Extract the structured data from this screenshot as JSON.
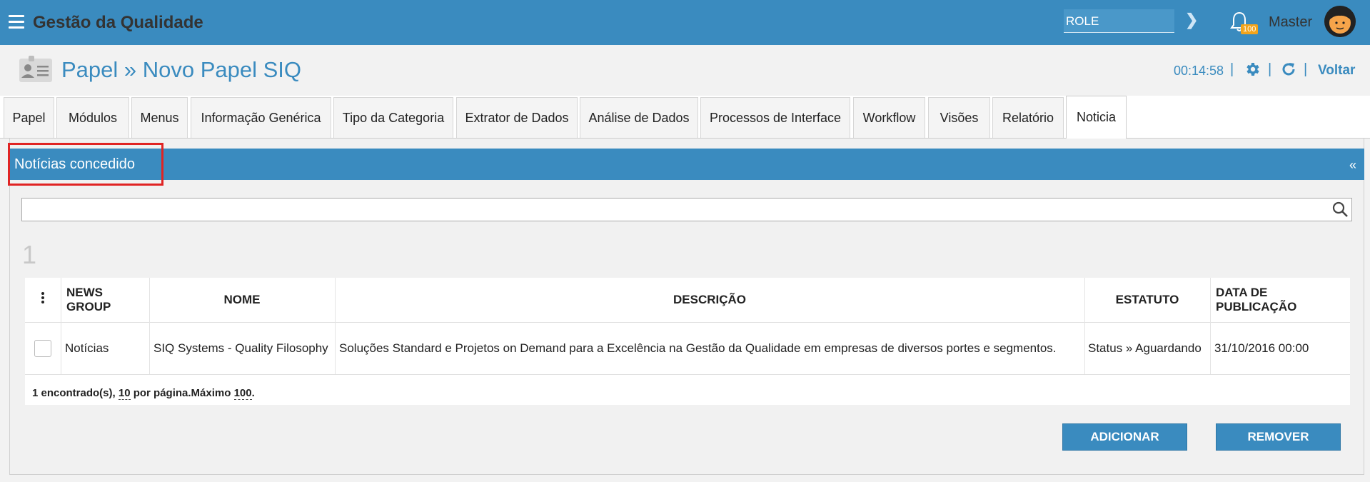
{
  "app": {
    "title": "Gestão da Qualidade"
  },
  "topbar": {
    "role_value": "ROLE",
    "notification_count": "100",
    "user_name": "Master"
  },
  "page": {
    "title": "Papel » Novo Papel SIQ",
    "timer": "00:14:58",
    "back_label": "Voltar",
    "separator": "|"
  },
  "tabs": [
    {
      "label": "Papel"
    },
    {
      "label": "Módulos"
    },
    {
      "label": "Menus"
    },
    {
      "label": "Informação Genérica"
    },
    {
      "label": "Tipo da Categoria"
    },
    {
      "label": "Extrator de Dados"
    },
    {
      "label": "Análise de Dados"
    },
    {
      "label": "Processos de Interface"
    },
    {
      "label": "Workflow"
    },
    {
      "label": "Visões"
    },
    {
      "label": "Relatório"
    },
    {
      "label": "Noticia"
    }
  ],
  "active_tab": "Noticia",
  "panel": {
    "title": "Notícias concedido",
    "collapse_glyph": "«"
  },
  "search": {
    "value": "",
    "placeholder": ""
  },
  "page_number": "1",
  "table": {
    "headers": [
      "NEWS GROUP",
      "NOME",
      "DESCRIÇÃO",
      "ESTATUTO",
      "DATA DE PUBLICAÇÃO"
    ],
    "rows": [
      {
        "news_group": "Notícias",
        "nome": "SIQ Systems - Quality Filosophy",
        "descricao": "Soluções Standard e Projetos on Demand para a Excelência na Gestão da Qualidade em empresas de diversos portes e segmentos.",
        "estatuto": "Status » Aguardando",
        "data": "31/10/2016 00:00"
      }
    ]
  },
  "pager": {
    "found": "1 encontrado(s),",
    "per_page": "10",
    "per_page_label": "por página.Máximo",
    "max": "100",
    "end": "."
  },
  "buttons": {
    "add": "ADICIONAR",
    "remove": "REMOVER"
  },
  "colors": {
    "primary": "#3a8bbf",
    "badge": "#f3a41b",
    "highlight": "#e02424"
  }
}
